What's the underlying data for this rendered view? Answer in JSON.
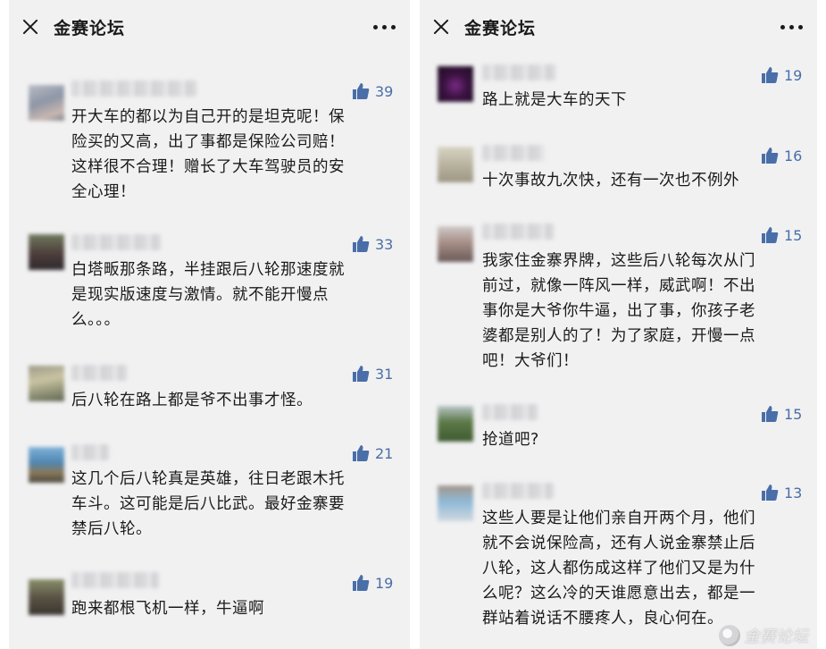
{
  "left": {
    "title": "金赛论坛",
    "comments": [
      {
        "likes": "39",
        "lines": [
          "开大车的都以为自己开的是坦克呢！保",
          "险买的又高，出了事都是保险公司赔！",
          "这样很不合理！赠长了大车驾驶员的安",
          "全心理！"
        ]
      },
      {
        "likes": "33",
        "lines": [
          "白塔畈那条路，半挂跟后八轮那速度就",
          "是现实版速度与激情。就不能开慢点",
          "么。。。"
        ]
      },
      {
        "likes": "31",
        "lines": [
          "后八轮在路上都是爷不出事才怪。"
        ]
      },
      {
        "likes": "21",
        "lines": [
          "这几个后八轮真是英雄，往日老跟木托",
          "车斗。这可能是后八比武。最好金寨要",
          "禁后八轮。"
        ]
      },
      {
        "likes": "19",
        "lines": [
          "跑来都根飞机一样，牛逼啊"
        ]
      }
    ]
  },
  "right": {
    "title": "金赛论坛",
    "comments": [
      {
        "likes": "19",
        "lines": [
          "路上就是大车的天下"
        ]
      },
      {
        "likes": "16",
        "lines": [
          "十次事故九次快，还有一次也不例外"
        ]
      },
      {
        "likes": "15",
        "lines": [
          "我家住金寨界牌，这些后八轮每次从门",
          "前过，就像一阵风一样，威武啊！不出",
          "事你是大爷你牛逼，出了事，你孩子老",
          "婆都是别人的了！为了家庭，开慢一点",
          "吧！大爷们！"
        ]
      },
      {
        "likes": "15",
        "lines": [
          "抢道吧?"
        ]
      },
      {
        "likes": "13",
        "lines": [
          "这些人要是让他们亲自开两个月，他们",
          "就不会说保险高，还有人说金寨禁止后",
          "八轮，这人都伤成这样了他们又是为什",
          "么呢？这么冷的天谁愿意出去，都是一",
          "群站着说话不腰疼人，良心何在。"
        ]
      }
    ]
  },
  "watermark": "金赛论坛",
  "colors": {
    "background": "#f1f1f2",
    "text": "#1a1a1a",
    "like": "#4a6ea8"
  },
  "icons": [
    "close-icon",
    "more-icon",
    "thumb-up-icon"
  ]
}
